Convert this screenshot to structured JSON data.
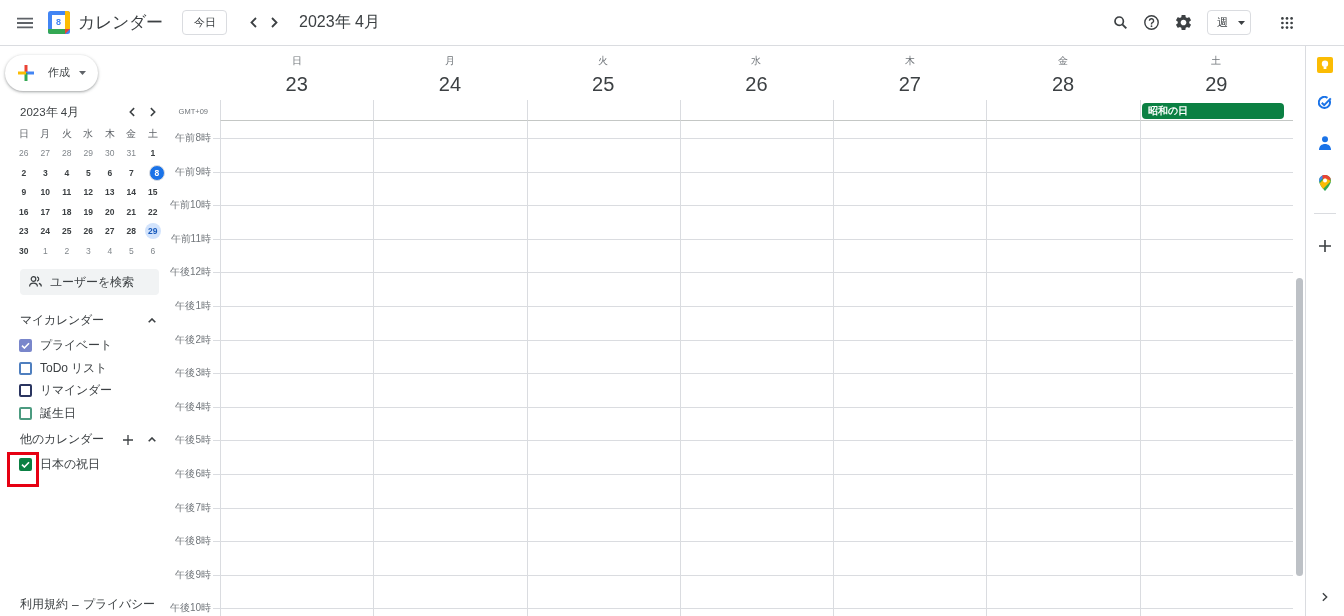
{
  "header": {
    "app_name": "カレンダー",
    "logo_text": "8",
    "today_button": "今日",
    "title": "2023年 4月",
    "view_selector": "週"
  },
  "sidebar": {
    "create_button": "作成",
    "mini_calendar": {
      "title": "2023年 4月",
      "weekdays": [
        "日",
        "月",
        "火",
        "水",
        "木",
        "金",
        "土"
      ],
      "weeks": [
        [
          {
            "day": "26",
            "other_month": true,
            "today": false,
            "selected": false
          },
          {
            "day": "27",
            "other_month": true,
            "today": false,
            "selected": false
          },
          {
            "day": "28",
            "other_month": true,
            "today": false,
            "selected": false
          },
          {
            "day": "29",
            "other_month": true,
            "today": false,
            "selected": false
          },
          {
            "day": "30",
            "other_month": true,
            "today": false,
            "selected": false
          },
          {
            "day": "31",
            "other_month": true,
            "today": false,
            "selected": false
          },
          {
            "day": "1",
            "other_month": false,
            "today": false,
            "selected": false
          }
        ],
        [
          {
            "day": "2",
            "other_month": false,
            "today": false,
            "selected": false
          },
          {
            "day": "3",
            "other_month": false,
            "today": false,
            "selected": false
          },
          {
            "day": "4",
            "other_month": false,
            "today": false,
            "selected": false
          },
          {
            "day": "5",
            "other_month": false,
            "today": false,
            "selected": false
          },
          {
            "day": "6",
            "other_month": false,
            "today": false,
            "selected": false
          },
          {
            "day": "7",
            "other_month": false,
            "today": false,
            "selected": false
          },
          {
            "day": "8",
            "other_month": false,
            "today": true,
            "selected": false
          }
        ],
        [
          {
            "day": "9",
            "other_month": false,
            "today": false,
            "selected": false
          },
          {
            "day": "10",
            "other_month": false,
            "today": false,
            "selected": false
          },
          {
            "day": "11",
            "other_month": false,
            "today": false,
            "selected": false
          },
          {
            "day": "12",
            "other_month": false,
            "today": false,
            "selected": false
          },
          {
            "day": "13",
            "other_month": false,
            "today": false,
            "selected": false
          },
          {
            "day": "14",
            "other_month": false,
            "today": false,
            "selected": false
          },
          {
            "day": "15",
            "other_month": false,
            "today": false,
            "selected": false
          }
        ],
        [
          {
            "day": "16",
            "other_month": false,
            "today": false,
            "selected": false
          },
          {
            "day": "17",
            "other_month": false,
            "today": false,
            "selected": false
          },
          {
            "day": "18",
            "other_month": false,
            "today": false,
            "selected": false
          },
          {
            "day": "19",
            "other_month": false,
            "today": false,
            "selected": false
          },
          {
            "day": "20",
            "other_month": false,
            "today": false,
            "selected": false
          },
          {
            "day": "21",
            "other_month": false,
            "today": false,
            "selected": false
          },
          {
            "day": "22",
            "other_month": false,
            "today": false,
            "selected": false
          }
        ],
        [
          {
            "day": "23",
            "other_month": false,
            "today": false,
            "selected": false
          },
          {
            "day": "24",
            "other_month": false,
            "today": false,
            "selected": false
          },
          {
            "day": "25",
            "other_month": false,
            "today": false,
            "selected": false
          },
          {
            "day": "26",
            "other_month": false,
            "today": false,
            "selected": false
          },
          {
            "day": "27",
            "other_month": false,
            "today": false,
            "selected": false
          },
          {
            "day": "28",
            "other_month": false,
            "today": false,
            "selected": false
          },
          {
            "day": "29",
            "other_month": false,
            "today": false,
            "selected": true
          }
        ],
        [
          {
            "day": "30",
            "other_month": false,
            "today": false,
            "selected": false
          },
          {
            "day": "1",
            "other_month": true,
            "today": false,
            "selected": false
          },
          {
            "day": "2",
            "other_month": true,
            "today": false,
            "selected": false
          },
          {
            "day": "3",
            "other_month": true,
            "today": false,
            "selected": false
          },
          {
            "day": "4",
            "other_month": true,
            "today": false,
            "selected": false
          },
          {
            "day": "5",
            "other_month": true,
            "today": false,
            "selected": false
          },
          {
            "day": "6",
            "other_month": true,
            "today": false,
            "selected": false
          }
        ]
      ]
    },
    "people_search": {
      "placeholder": "ユーザーを検索"
    },
    "calendar_groups": [
      {
        "title": "マイカレンダー",
        "expanded": true,
        "add_button": false,
        "items": [
          {
            "label": "プライベート",
            "checked": true,
            "highlighted": false,
            "color": "#7986cb"
          },
          {
            "label": "ToDo リスト",
            "checked": false,
            "highlighted": false,
            "color": "#4f7fbf"
          },
          {
            "label": "リマインダー",
            "checked": false,
            "highlighted": false,
            "color": "#2a3560"
          },
          {
            "label": "誕生日",
            "checked": false,
            "highlighted": false,
            "color": "#4c9b80"
          }
        ]
      },
      {
        "title": "他のカレンダー",
        "expanded": true,
        "add_button": true,
        "items": [
          {
            "label": "日本の祝日",
            "checked": true,
            "highlighted": true,
            "color": "#0b8043"
          }
        ]
      }
    ],
    "footer": {
      "links": [
        "利用規約",
        "プライバシー"
      ],
      "separator": "–"
    }
  },
  "week": {
    "timezone": "GMT+09",
    "days": [
      {
        "weekday": "日",
        "date": "23"
      },
      {
        "weekday": "月",
        "date": "24"
      },
      {
        "weekday": "火",
        "date": "25"
      },
      {
        "weekday": "水",
        "date": "26"
      },
      {
        "weekday": "木",
        "date": "27"
      },
      {
        "weekday": "金",
        "date": "28"
      },
      {
        "weekday": "土",
        "date": "29",
        "all_day_events": [
          {
            "title": "昭和の日",
            "color": "#0b8043"
          }
        ]
      }
    ],
    "hours": [
      "午前8時",
      "午前9時",
      "午前10時",
      "午前11時",
      "午後12時",
      "午後1時",
      "午後2時",
      "午後3時",
      "午後4時",
      "午後5時",
      "午後6時",
      "午後7時",
      "午後8時",
      "午後9時",
      "午後10時"
    ]
  }
}
